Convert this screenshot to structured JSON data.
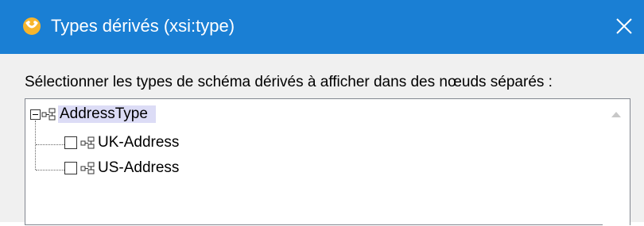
{
  "window": {
    "title": "Types dérivés (xsi:type)",
    "accent_color": "#1a7fd4",
    "app_icon": "altova-icon",
    "close_icon": "close-icon"
  },
  "dialog": {
    "instruction": "Sélectionner les types de schéma dérivés à afficher dans des nœuds séparés :"
  },
  "tree": {
    "root": {
      "label": "AddressType",
      "expanded": true,
      "icon": "complex-type-icon"
    },
    "children": [
      {
        "label": "UK-Address",
        "checked": false,
        "icon": "complex-type-icon"
      },
      {
        "label": "US-Address",
        "checked": false,
        "icon": "complex-type-icon"
      }
    ]
  }
}
